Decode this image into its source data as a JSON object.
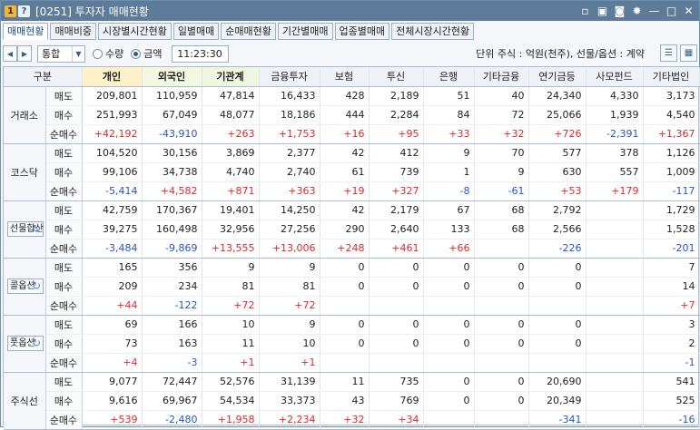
{
  "window": {
    "badge_one": "1",
    "badge_help": "?",
    "title": "[0251] 투자자 매매현황"
  },
  "titlebar_icons": [
    "window-icon",
    "copy-icon",
    "camera-icon",
    "gear-icon",
    "minimize-icon",
    "maximize-icon",
    "close-icon"
  ],
  "titlebar_glyphs": [
    "▫",
    "▣",
    "◙",
    "✹",
    "—",
    "□",
    "✕"
  ],
  "tabs": [
    {
      "label": "매매현황",
      "active": true
    },
    {
      "label": "매매비중"
    },
    {
      "label": "시장별시간현황"
    },
    {
      "label": "일별매매"
    },
    {
      "label": "순매매현황"
    },
    {
      "label": "기간별매매"
    },
    {
      "label": "업종별매매"
    },
    {
      "label": "전체시장시간현황"
    }
  ],
  "toolbar": {
    "market_select": "통합",
    "radio_qty": "수량",
    "radio_amt": "금액",
    "radio_selected": "금액",
    "time": "11:23:30",
    "unit_text": "단위 주식 : 억원(천주), 선물/옵션 : 계약"
  },
  "headers": [
    "구분",
    "",
    "개인",
    "외국인",
    "기관계",
    "금융투자",
    "보험",
    "투신",
    "은행",
    "기타금융",
    "연기금등",
    "사모펀드",
    "기타법인"
  ],
  "groups": [
    {
      "name": "거래소",
      "button": false,
      "rows": [
        {
          "label": "매도",
          "values": [
            "209,801",
            "110,959",
            "47,814",
            "16,433",
            "428",
            "2,189",
            "51",
            "40",
            "24,340",
            "4,330",
            "3,173"
          ]
        },
        {
          "label": "매수",
          "values": [
            "251,993",
            "67,049",
            "48,077",
            "18,186",
            "444",
            "2,284",
            "84",
            "72",
            "25,066",
            "1,939",
            "4,540"
          ]
        },
        {
          "label": "순매수",
          "values": [
            "+42,192",
            "-43,910",
            "+263",
            "+1,753",
            "+16",
            "+95",
            "+33",
            "+32",
            "+726",
            "-2,391",
            "+1,367"
          ]
        }
      ]
    },
    {
      "name": "코스닥",
      "button": false,
      "rows": [
        {
          "label": "매도",
          "values": [
            "104,520",
            "30,156",
            "3,869",
            "2,377",
            "42",
            "412",
            "9",
            "70",
            "577",
            "378",
            "1,126"
          ]
        },
        {
          "label": "매수",
          "values": [
            "99,106",
            "34,738",
            "4,740",
            "2,740",
            "61",
            "739",
            "1",
            "9",
            "630",
            "557",
            "1,009"
          ]
        },
        {
          "label": "순매수",
          "values": [
            "-5,414",
            "+4,582",
            "+871",
            "+363",
            "+19",
            "+327",
            "-8",
            "-61",
            "+53",
            "+179",
            "-117"
          ]
        }
      ]
    },
    {
      "name": "선물합산",
      "button": true,
      "rows": [
        {
          "label": "매도",
          "values": [
            "42,759",
            "170,367",
            "19,401",
            "14,250",
            "42",
            "2,179",
            "67",
            "68",
            "2,792",
            "",
            "1,729"
          ]
        },
        {
          "label": "매수",
          "values": [
            "39,275",
            "160,498",
            "32,956",
            "27,256",
            "290",
            "2,640",
            "133",
            "68",
            "2,566",
            "",
            "1,528"
          ]
        },
        {
          "label": "순매수",
          "values": [
            "-3,484",
            "-9,869",
            "+13,555",
            "+13,006",
            "+248",
            "+461",
            "+66",
            "",
            "-226",
            "",
            "-201"
          ]
        }
      ]
    },
    {
      "name": "콜옵션",
      "button": true,
      "rows": [
        {
          "label": "매도",
          "values": [
            "165",
            "356",
            "9",
            "9",
            "0",
            "0",
            "0",
            "0",
            "0",
            "",
            "7"
          ]
        },
        {
          "label": "매수",
          "values": [
            "209",
            "234",
            "81",
            "81",
            "0",
            "0",
            "0",
            "0",
            "0",
            "",
            "14"
          ]
        },
        {
          "label": "순매수",
          "values": [
            "+44",
            "-122",
            "+72",
            "+72",
            "",
            "",
            "",
            "",
            "",
            "",
            "+7"
          ]
        }
      ]
    },
    {
      "name": "풋옵션",
      "button": true,
      "rows": [
        {
          "label": "매도",
          "values": [
            "69",
            "166",
            "10",
            "9",
            "0",
            "0",
            "0",
            "0",
            "0",
            "",
            "3"
          ]
        },
        {
          "label": "매수",
          "values": [
            "73",
            "163",
            "11",
            "10",
            "0",
            "0",
            "0",
            "0",
            "0",
            "",
            "2"
          ]
        },
        {
          "label": "순매수",
          "values": [
            "+4",
            "-3",
            "+1",
            "+1",
            "",
            "",
            "",
            "",
            "",
            "",
            "-1"
          ]
        }
      ]
    },
    {
      "name": "주식선",
      "button": false,
      "rows": [
        {
          "label": "매도",
          "values": [
            "9,077",
            "72,447",
            "52,576",
            "31,139",
            "11",
            "735",
            "0",
            "0",
            "20,690",
            "",
            "541"
          ]
        },
        {
          "label": "매수",
          "values": [
            "9,616",
            "69,967",
            "54,534",
            "33,373",
            "43",
            "769",
            "0",
            "0",
            "20,349",
            "",
            "525"
          ]
        },
        {
          "label": "순매수",
          "values": [
            "+539",
            "-2,480",
            "+1,958",
            "+2,234",
            "+32",
            "+34",
            "",
            "",
            "-341",
            "",
            "-16"
          ]
        }
      ]
    }
  ]
}
